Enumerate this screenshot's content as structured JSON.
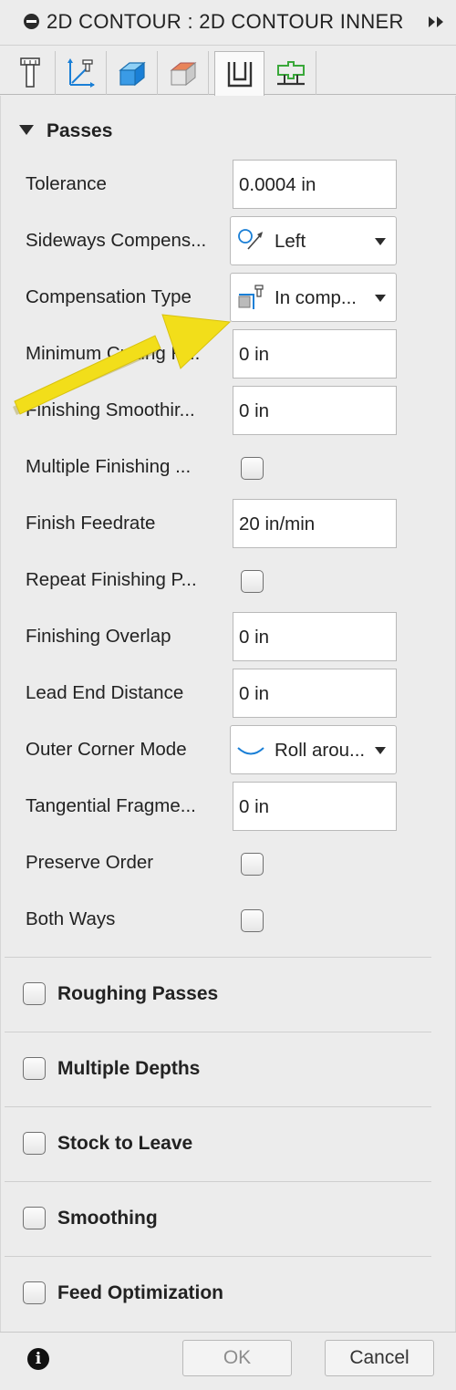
{
  "title": "2D CONTOUR : 2D CONTOUR INNER",
  "tabs": [
    {
      "icon": "tool-icon",
      "active": false
    },
    {
      "icon": "geometry-icon",
      "active": false
    },
    {
      "icon": "heights-icon",
      "active": false
    },
    {
      "icon": "stock-icon",
      "active": false
    },
    {
      "icon": "passes-icon",
      "active": true
    },
    {
      "icon": "linking-icon",
      "active": false
    }
  ],
  "passes": {
    "title": "Passes",
    "tolerance": {
      "label": "Tolerance",
      "value": "0.0004 in"
    },
    "sideways_compensation": {
      "label": "Sideways Compens...",
      "value": "Left",
      "icon": "left-compensation-icon"
    },
    "compensation_type": {
      "label": "Compensation Type",
      "value": "In comp...",
      "icon": "in-computer-icon"
    },
    "minimum_cutting_radius": {
      "label": "Minimum Cutting R...",
      "value": "0 in"
    },
    "finishing_smoothing": {
      "label": "Finishing Smoothir...",
      "value": "0 in"
    },
    "multiple_finishing": {
      "label": "Multiple Finishing ...",
      "checked": false
    },
    "finish_feedrate": {
      "label": "Finish Feedrate",
      "value": "20 in/min"
    },
    "repeat_finishing": {
      "label": "Repeat Finishing P...",
      "checked": false
    },
    "finishing_overlap": {
      "label": "Finishing Overlap",
      "value": "0 in"
    },
    "lead_end_distance": {
      "label": "Lead End Distance",
      "value": "0 in"
    },
    "outer_corner_mode": {
      "label": "Outer Corner Mode",
      "value": "Roll arou...",
      "icon": "roll-around-icon"
    },
    "tangential_fragment": {
      "label": "Tangential Fragme...",
      "value": "0 in"
    },
    "preserve_order": {
      "label": "Preserve Order",
      "checked": false
    },
    "both_ways": {
      "label": "Both Ways",
      "checked": false
    }
  },
  "groups": [
    {
      "label": "Roughing Passes",
      "checked": false
    },
    {
      "label": "Multiple Depths",
      "checked": false
    },
    {
      "label": "Stock to Leave",
      "checked": false
    },
    {
      "label": "Smoothing",
      "checked": false
    },
    {
      "label": "Feed Optimization",
      "checked": false
    }
  ],
  "footer": {
    "ok_label": "OK",
    "cancel_label": "Cancel",
    "info_glyph": "i"
  },
  "colors": {
    "accent_blue": "#1a7fd6",
    "annotation_yellow": "#f2de1a",
    "stock_orange": "#e8845a"
  }
}
